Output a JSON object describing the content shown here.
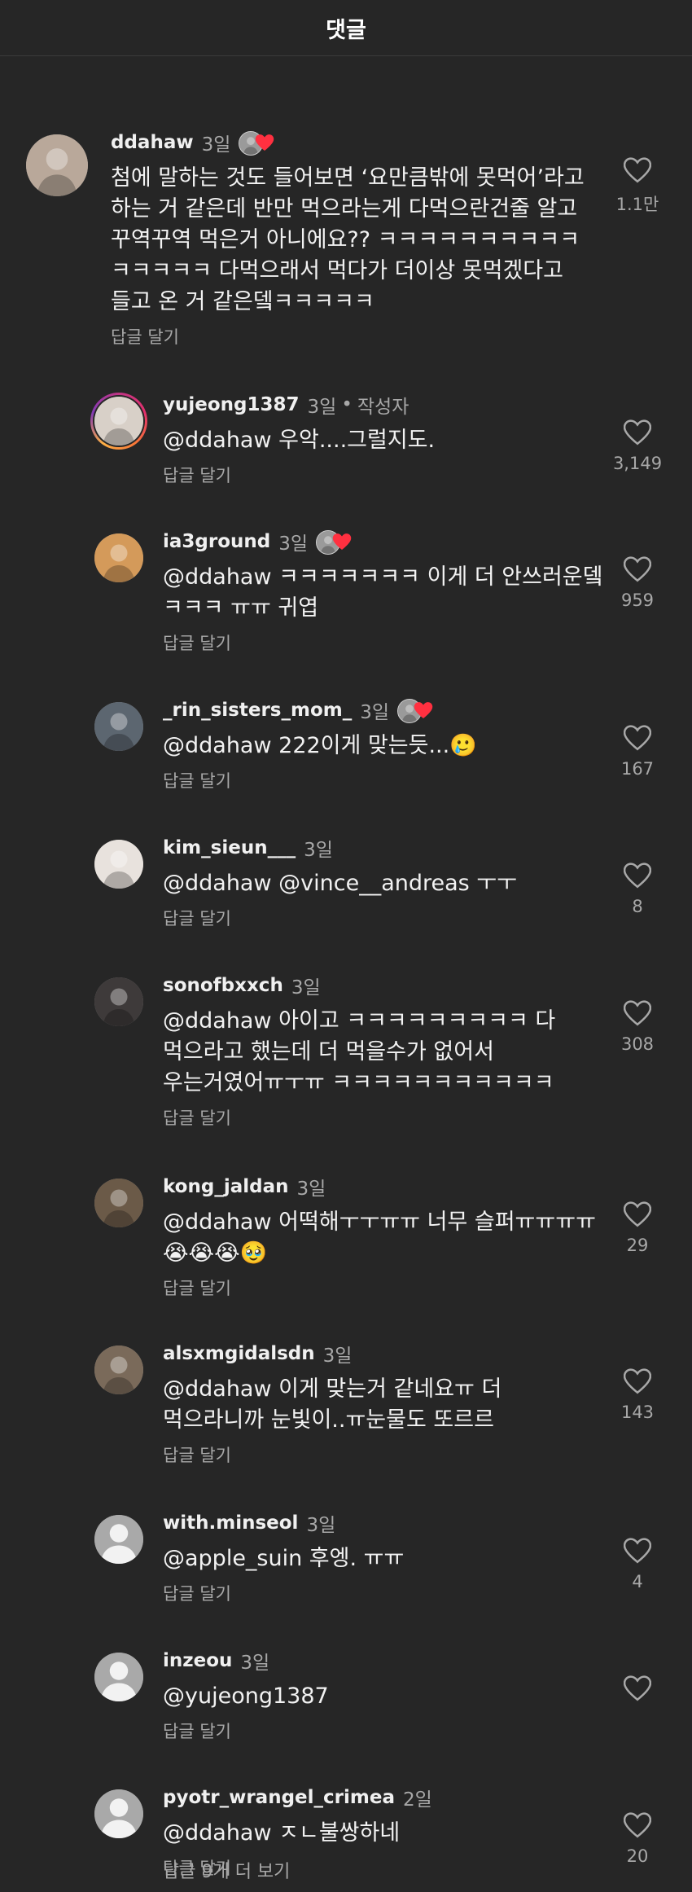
{
  "header": {
    "title": "댓글"
  },
  "comments": [
    {
      "username": "ddahaw",
      "time": "3일",
      "liked_by_author": true,
      "text": "첨에 말하는 것도 들어보면 ‘요만큼밖에 못먹어’라고\n하는 거 같은데 반만 먹으라는게 다먹으란건줄 알고\n꾸역꾸역 먹은거 아니에요?? ㅋㅋㅋㅋㅋㅋㅋㅋㅋㅋ\nㅋㅋㅋㅋㅋ 다먹으래서 먹다가 더이상 못먹겠다고\n들고 온 거 같은뎈ㅋㅋㅋㅋㅋ",
      "reply": "답글 달기",
      "likes": "1.1만"
    },
    {
      "username": "yujeong1387",
      "time": "3일",
      "author_sep": "•",
      "author_label": "작성자",
      "text": "@ddahaw 우악....그럴지도.",
      "reply": "답글 달기",
      "likes": "3,149"
    },
    {
      "username": "ia3ground",
      "time": "3일",
      "liked_by_author": true,
      "text": "@ddahaw ㅋㅋㅋㅋㅋㅋㅋ 이게 더 안쓰러운뎈\nㅋㅋㅋ ㅠㅠ 귀엽",
      "reply": "답글 달기",
      "likes": "959"
    },
    {
      "username": "_rin_sisters_mom_",
      "time": "3일",
      "liked_by_author": true,
      "text": "@ddahaw 222이게 맞는듯...🥲",
      "reply": "답글 달기",
      "likes": "167"
    },
    {
      "username": "kim_sieun___",
      "time": "3일",
      "text": "@ddahaw @vince__andreas ㅜㅜ",
      "reply": "답글 달기",
      "likes": "8"
    },
    {
      "username": "sonofbxxch",
      "time": "3일",
      "text": "@ddahaw 아이고 ㅋㅋㅋㅋㅋㅋㅋㅋㅋ 다\n먹으라고 했는데 더 먹을수가 없어서\n우는거였어ㅠㅜㅠ ㅋㅋㅋㅋㅋㅋㅋㅋㅋㅋㅋ",
      "reply": "답글 달기",
      "likes": "308"
    },
    {
      "username": "kong_jaldan",
      "time": "3일",
      "text": "@ddahaw 어떡해ㅜㅜㅠㅠ 너무 슬퍼ㅠㅠㅠㅠ\n😭😭😭🥹",
      "reply": "답글 달기",
      "likes": "29"
    },
    {
      "username": "alsxmgidalsdn",
      "time": "3일",
      "text": "@ddahaw 이게 맞는거 같네요ㅠ 더\n먹으라니까 눈빛이..ㅠ눈물도 또르르",
      "reply": "답글 달기",
      "likes": "143"
    },
    {
      "username": "with.minseol",
      "time": "3일",
      "text": "@apple_suin 후엥. ㅠㅠ",
      "reply": "답글 달기",
      "likes": "4"
    },
    {
      "username": "inzeou",
      "time": "3일",
      "text": "@yujeong1387",
      "reply": "답글 달기",
      "likes": ""
    },
    {
      "username": "pyotr_wrangel_crimea",
      "time": "2일",
      "text": "@ddahaw ㅈㄴ불쌍하네",
      "reply": "답글 달기",
      "likes": "20"
    }
  ],
  "more_replies": "답글 9개 더 보기",
  "icons": {
    "like": "heart-outline-icon",
    "author_like": "heart-filled-icon"
  },
  "colors": {
    "background": "#262626",
    "heart_red": "#ff3040",
    "muted": "#a8a8a8"
  }
}
